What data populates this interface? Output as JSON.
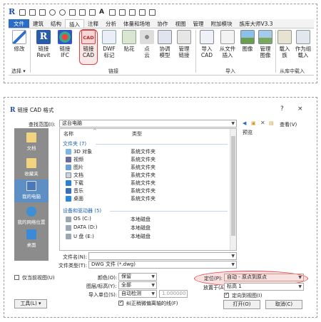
{
  "ribbon": {
    "tabs": [
      "文件",
      "建筑",
      "结构",
      "插入",
      "注释",
      "分析",
      "体量和场地",
      "协作",
      "视图",
      "管理",
      "附加模块",
      "族库大师V3.3"
    ],
    "active_tab": "插入",
    "buttons": {
      "modify": "修改",
      "link_revit": "链接\nRevit",
      "link_ifc": "链接\nIFC",
      "link_cad": "链接\nCAD",
      "dwf": "DWF\n标记",
      "decal": "贴花",
      "point_cloud": "点\n云",
      "coord_model": "协调\n模型",
      "manage_links": "管理\n链接",
      "import_cad": "导入\nCAD",
      "from_file_insert": "从文件\n插入",
      "image": "图像",
      "manage_images": "管理\n图像",
      "load_family": "载入\n族",
      "load_as_group": "作为组\n载入"
    },
    "panels": {
      "select": "选择 ▾",
      "link": "链接",
      "import": "导入",
      "load_from_library": "从库中载入"
    },
    "cad_label": "CAD"
  },
  "dialog": {
    "title": "链接 CAD 格式",
    "help": "?",
    "close": "×",
    "lookin_label": "查找范围(I):",
    "lookin_value": "这台电脑",
    "view_label": "查看(V)",
    "preview_label": "预览",
    "places": [
      "文档",
      "收藏夹",
      "我的电脑",
      "我的网络位置",
      "桌面"
    ],
    "columns": {
      "name": "名称",
      "type": "类型"
    },
    "groups": {
      "folders": "文件夹 (7)",
      "drives": "设备和驱动器 (5)"
    },
    "folders": [
      {
        "name": "3D 对象",
        "type": "系统文件夹"
      },
      {
        "name": "视频",
        "type": "系统文件夹"
      },
      {
        "name": "图片",
        "type": "系统文件夹"
      },
      {
        "name": "文档",
        "type": "系统文件夹"
      },
      {
        "name": "下载",
        "type": "系统文件夹"
      },
      {
        "name": "音乐",
        "type": "系统文件夹"
      },
      {
        "name": "桌面",
        "type": "系统文件夹"
      }
    ],
    "drives": [
      {
        "name": "OS (C:)",
        "type": "本地磁盘"
      },
      {
        "name": "DATA (D:)",
        "type": "本地磁盘"
      },
      {
        "name": "U 盘 (E:)",
        "type": "本地磁盘"
      }
    ],
    "filename_label": "文件名(N):",
    "filename_value": "",
    "filetype_label": "文件类型(T):",
    "filetype_value": "DWG 文件 (*.dwg)",
    "current_view_only": "仅当前视图(U)",
    "colors_label": "颜色(O):",
    "colors_value": "保留",
    "layers_label": "图层/标高(Y):",
    "layers_value": "全部",
    "import_units_label": "导入单位(S):",
    "import_units_value": "自动检测",
    "units_scale": "1.000000",
    "correct_lines": "纠正稍微偏离轴的线(F)",
    "positioning_label": "定位(P):",
    "positioning_value": "自动 - 原点到原点",
    "place_at_label": "放置于(A):",
    "place_at_value": "标高 1",
    "orient_to_view": "定向到视图(I)",
    "tools_label": "工具(L)",
    "open_label": "打开(O)",
    "cancel_label": "取消(C)"
  }
}
